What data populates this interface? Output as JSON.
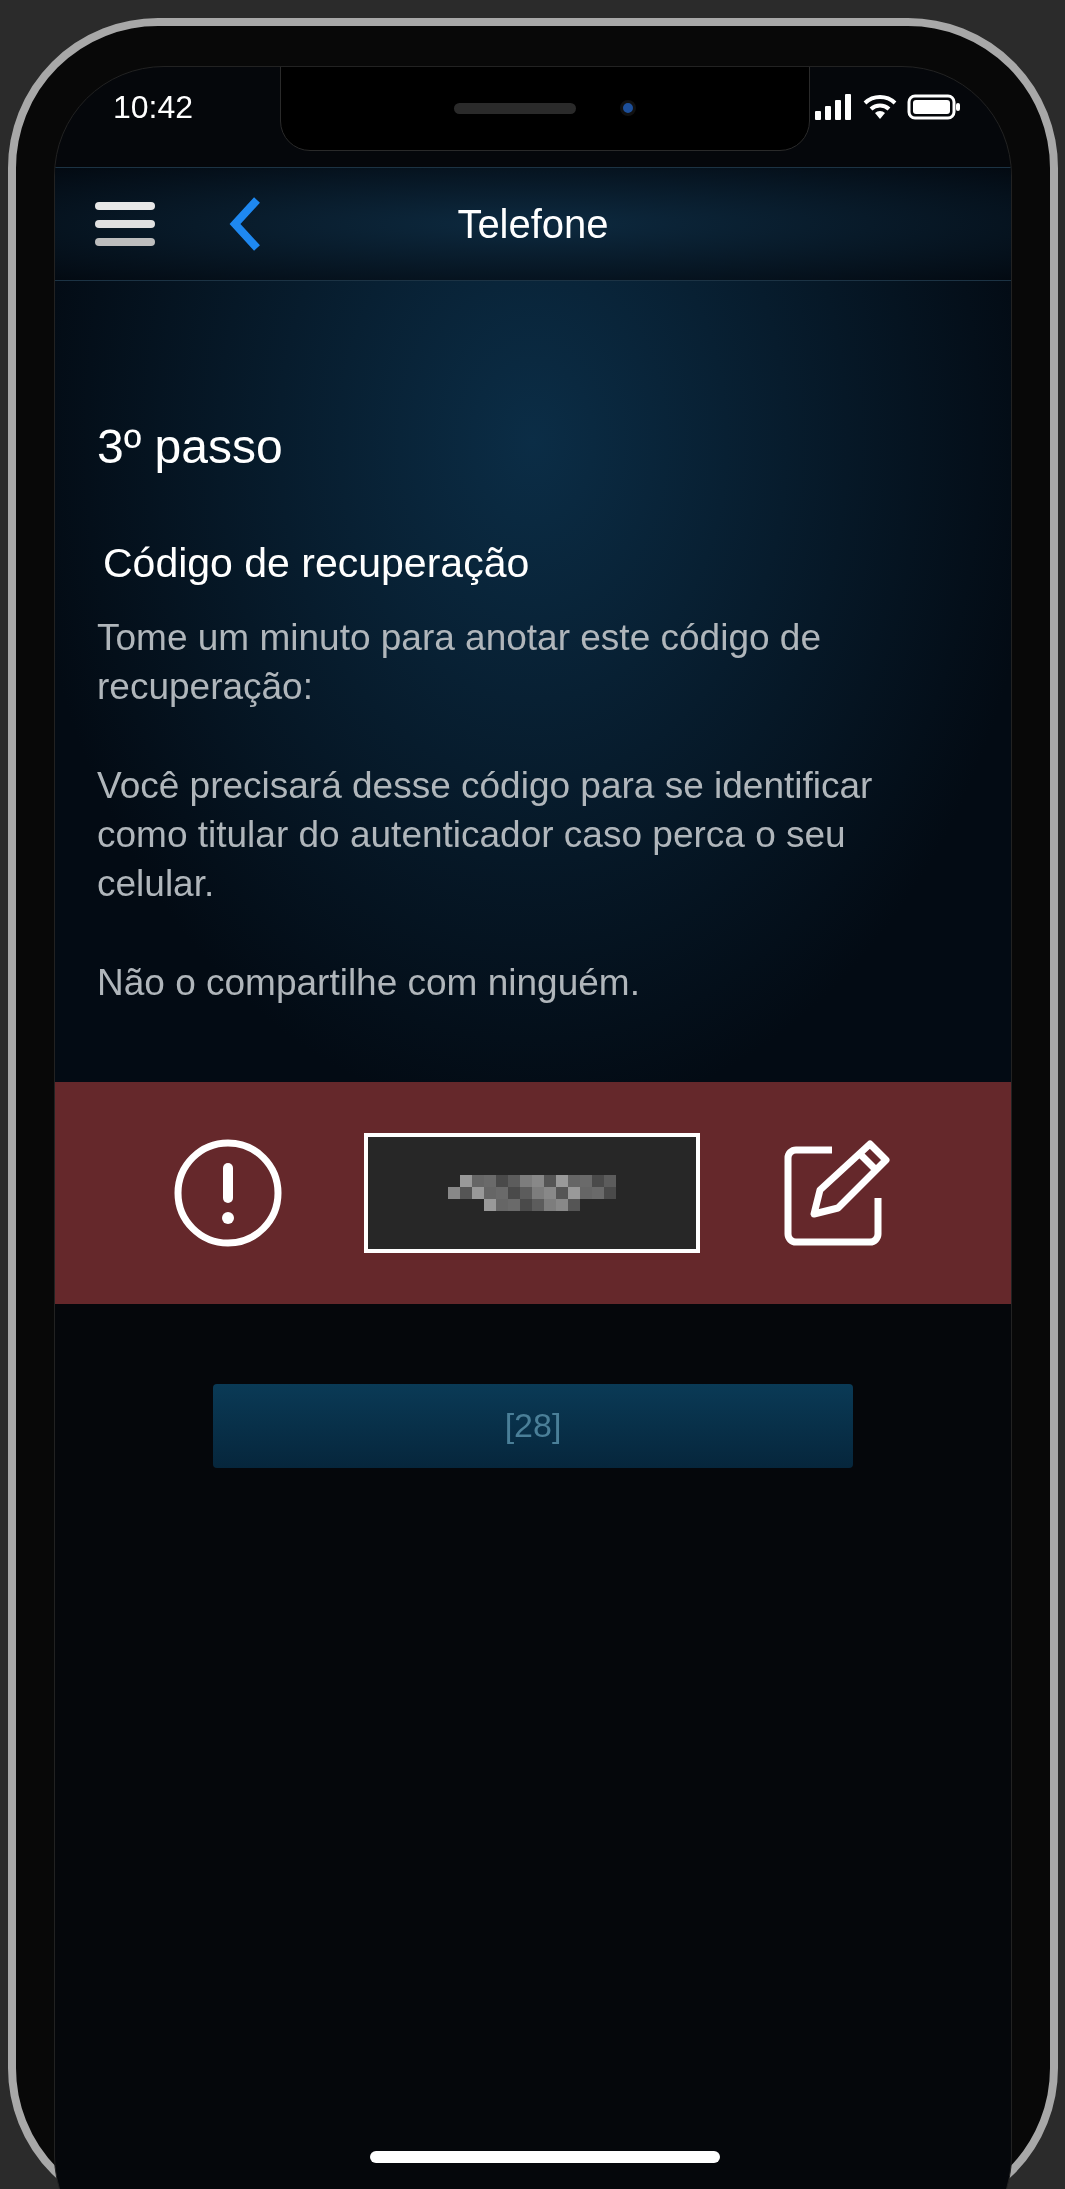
{
  "status_bar": {
    "time": "10:42"
  },
  "header": {
    "title": "Telefone"
  },
  "step": {
    "title": "3º passo",
    "subtitle": "Código de recuperação",
    "paragraphs": [
      "Tome um minuto para anotar este código de recuperação:",
      "Você precisará desse código para se identificar como titular do autenticador caso perca o seu celular.",
      "Não o compartilhe com ninguém."
    ]
  },
  "button": {
    "label": "[28]",
    "disabled": true
  }
}
